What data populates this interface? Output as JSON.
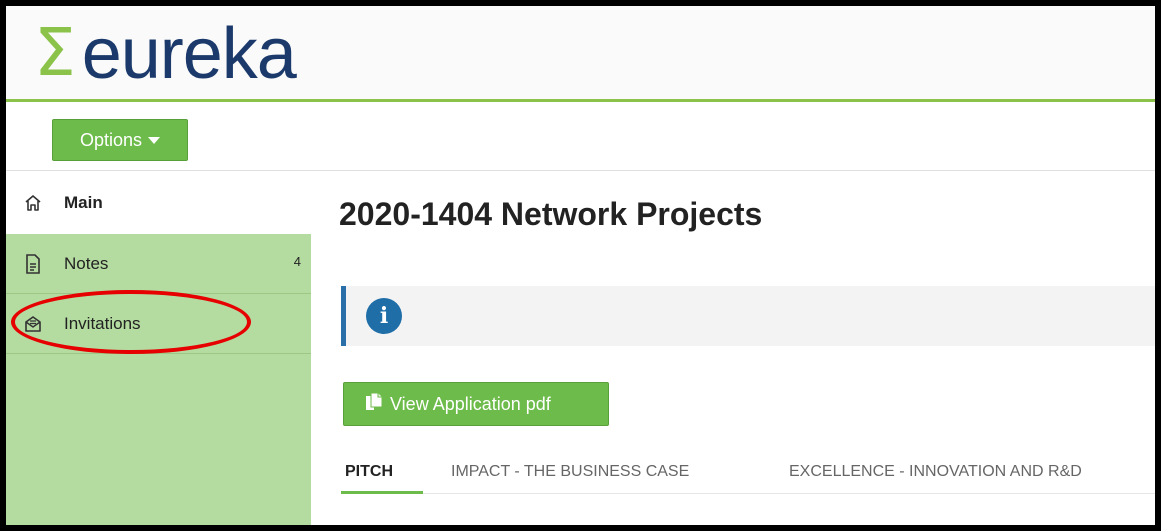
{
  "brand": {
    "sigma": "Σ",
    "name": "eureka"
  },
  "options": {
    "label": "Options"
  },
  "sidebar": {
    "items": [
      {
        "id": "main",
        "label": "Main",
        "icon": "home-icon"
      },
      {
        "id": "notes",
        "label": "Notes",
        "icon": "document-icon",
        "count": "4"
      },
      {
        "id": "invitations",
        "label": "Invitations",
        "icon": "envelope-icon"
      }
    ]
  },
  "main": {
    "title": "2020-1404 Network Projects",
    "info_icon": "i",
    "pdf_button": "View Application pdf",
    "tabs": [
      {
        "label": "PITCH",
        "active": true
      },
      {
        "label": "IMPACT - THE BUSINESS CASE"
      },
      {
        "label": "EXCELLENCE - INNOVATION AND R&D"
      }
    ]
  },
  "colors": {
    "brand_green": "#8bc34a",
    "button_green": "#6dbb4a",
    "sidebar_green": "#b4dba0",
    "logo_navy": "#1b3a6b",
    "info_blue": "#1f6ea8",
    "highlight_red": "#e60000"
  }
}
